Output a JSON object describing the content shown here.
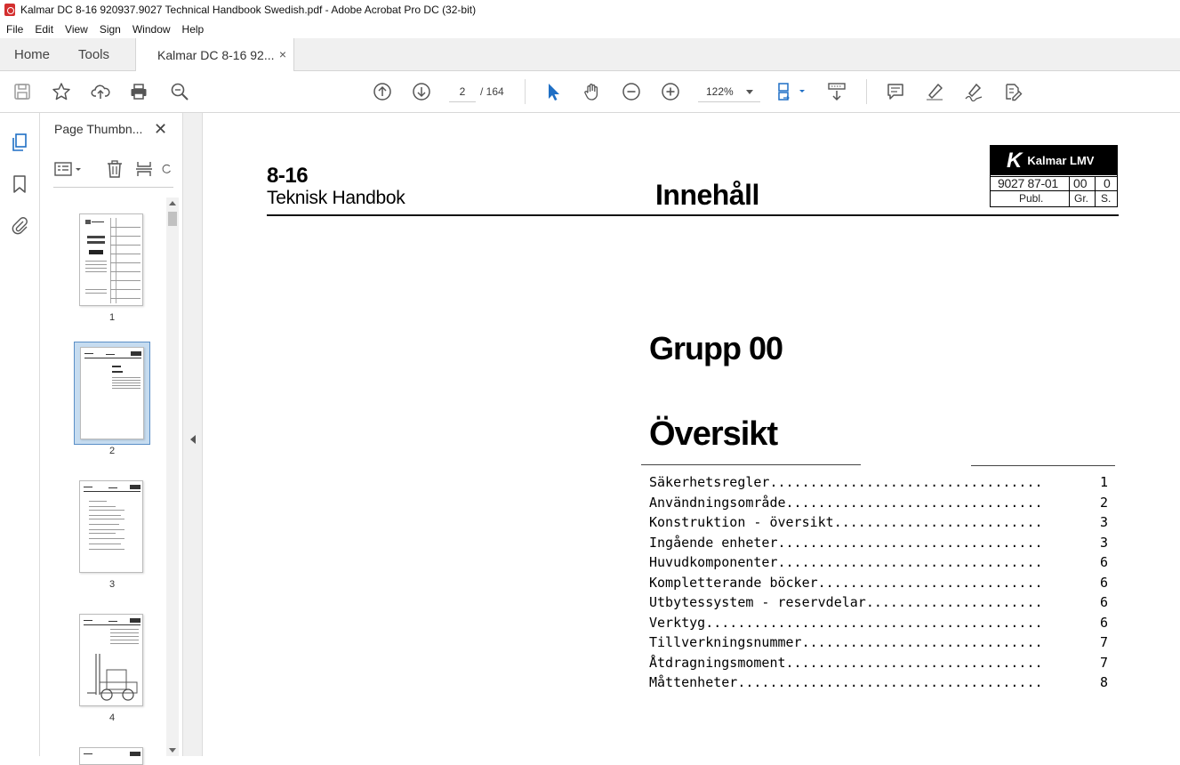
{
  "window": {
    "title": "Kalmar DC 8-16 920937.9027 Technical Handbook Swedish.pdf - Adobe Acrobat Pro DC (32-bit)"
  },
  "menu": [
    "File",
    "Edit",
    "View",
    "Sign",
    "Window",
    "Help"
  ],
  "tabs": {
    "home": "Home",
    "tools": "Tools",
    "document": "Kalmar DC 8-16 92...",
    "close": "×"
  },
  "toolbar": {
    "page_current": "2",
    "page_total": "/ 164",
    "zoom": "122%",
    "icons": [
      "save-icon",
      "star-icon",
      "upload-icon",
      "print-icon",
      "search-zoom-icon",
      "prev-page-icon",
      "next-page-icon",
      "select-cursor-icon",
      "hand-icon",
      "zoom-out-icon",
      "zoom-in-icon",
      "page-layout-icon",
      "scroll-mode-icon",
      "comment-icon",
      "highlight-icon",
      "sign-icon",
      "fill-sign-icon"
    ]
  },
  "sidebar": {
    "title": "Page Thumbn...",
    "close": "✕",
    "thumbnails": [
      {
        "num": "1"
      },
      {
        "num": "2",
        "selected": true
      },
      {
        "num": "3"
      },
      {
        "num": "4"
      }
    ]
  },
  "page": {
    "model": "8-16",
    "handbook": "Teknisk Handbok",
    "heading": "Innehåll",
    "logo": {
      "k": "K",
      "brand": "Kalmar LMV",
      "pub_number": "9027 87-01",
      "group": "00",
      "sheet": "0",
      "cap_publ": "Publ.",
      "cap_gr": "Gr.",
      "cap_s": "S."
    },
    "group": "Grupp 00",
    "section": "Översikt",
    "toc": [
      {
        "title": "Säkerhetsregler..................................",
        "page": "1"
      },
      {
        "title": "Användningsområde................................",
        "page": "2"
      },
      {
        "title": "Konstruktion - översikt..........................",
        "page": "3"
      },
      {
        "title": "Ingående enheter.................................",
        "page": "3"
      },
      {
        "title": "Huvudkomponenter.................................",
        "page": "6"
      },
      {
        "title": "Kompletterande böcker............................",
        "page": "6"
      },
      {
        "title": "Utbytessystem - reservdelar......................",
        "page": "6"
      },
      {
        "title": "Verktyg..........................................",
        "page": "6"
      },
      {
        "title": "Tillverkningsnummer..............................",
        "page": "7"
      },
      {
        "title": "Åtdragningsmoment................................",
        "page": "7"
      },
      {
        "title": "Måttenheter......................................",
        "page": "8"
      }
    ]
  }
}
